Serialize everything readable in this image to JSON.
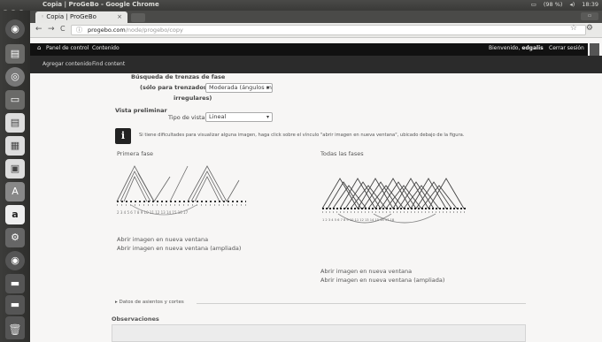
{
  "os": {
    "window_title": "Copia | ProGeBo - Google Chrome",
    "battery": "(98 %)",
    "clock": "18:39"
  },
  "browser": {
    "tab_title": "Copia | ProGeBo",
    "tab_close": "×",
    "url_host": "progebo.com",
    "url_path": "/node/progebo/copy",
    "back": "←",
    "forward": "→",
    "reload": "C",
    "star": "☆",
    "menu": "⚙"
  },
  "site_nav": {
    "home_icon": "house-icon",
    "items": [
      "Panel de control",
      "Contenido"
    ],
    "welcome": "Bienvenido,",
    "username": "edgalis",
    "logout": "Cerrar sesión"
  },
  "sub_nav": {
    "items": [
      "Agregar contenido",
      "Find content"
    ]
  },
  "form": {
    "search_label": "Búsqueda de trenzas de fase",
    "only_label": "(sólo para trenzados",
    "irregular_label": "irregulares)",
    "search_value": "Moderada (ángulos m",
    "preview_section": "Vista preliminar",
    "view_type_label": "Tipo de vista",
    "view_type_value": "Lineal"
  },
  "info": {
    "text": "Si tiene dificultades para visualizar alguna imagen, haga click sobre el vínculo \"abrir imagen en nueva ventana\", ubicado debajo de la figura."
  },
  "figures": {
    "first_title": "Primera fase",
    "all_title": "Todas las fases",
    "first_links": [
      "Abrir imagen en nueva ventana",
      "Abrir imagen en nueva ventana (ampliada)"
    ],
    "all_links": [
      "Abrir imagen en nueva ventana",
      "Abrir imagen en nueva ventana (ampliada)"
    ]
  },
  "details": {
    "toggle": "▸ Datos de asientos y cortes",
    "observations": "Observaciones"
  }
}
